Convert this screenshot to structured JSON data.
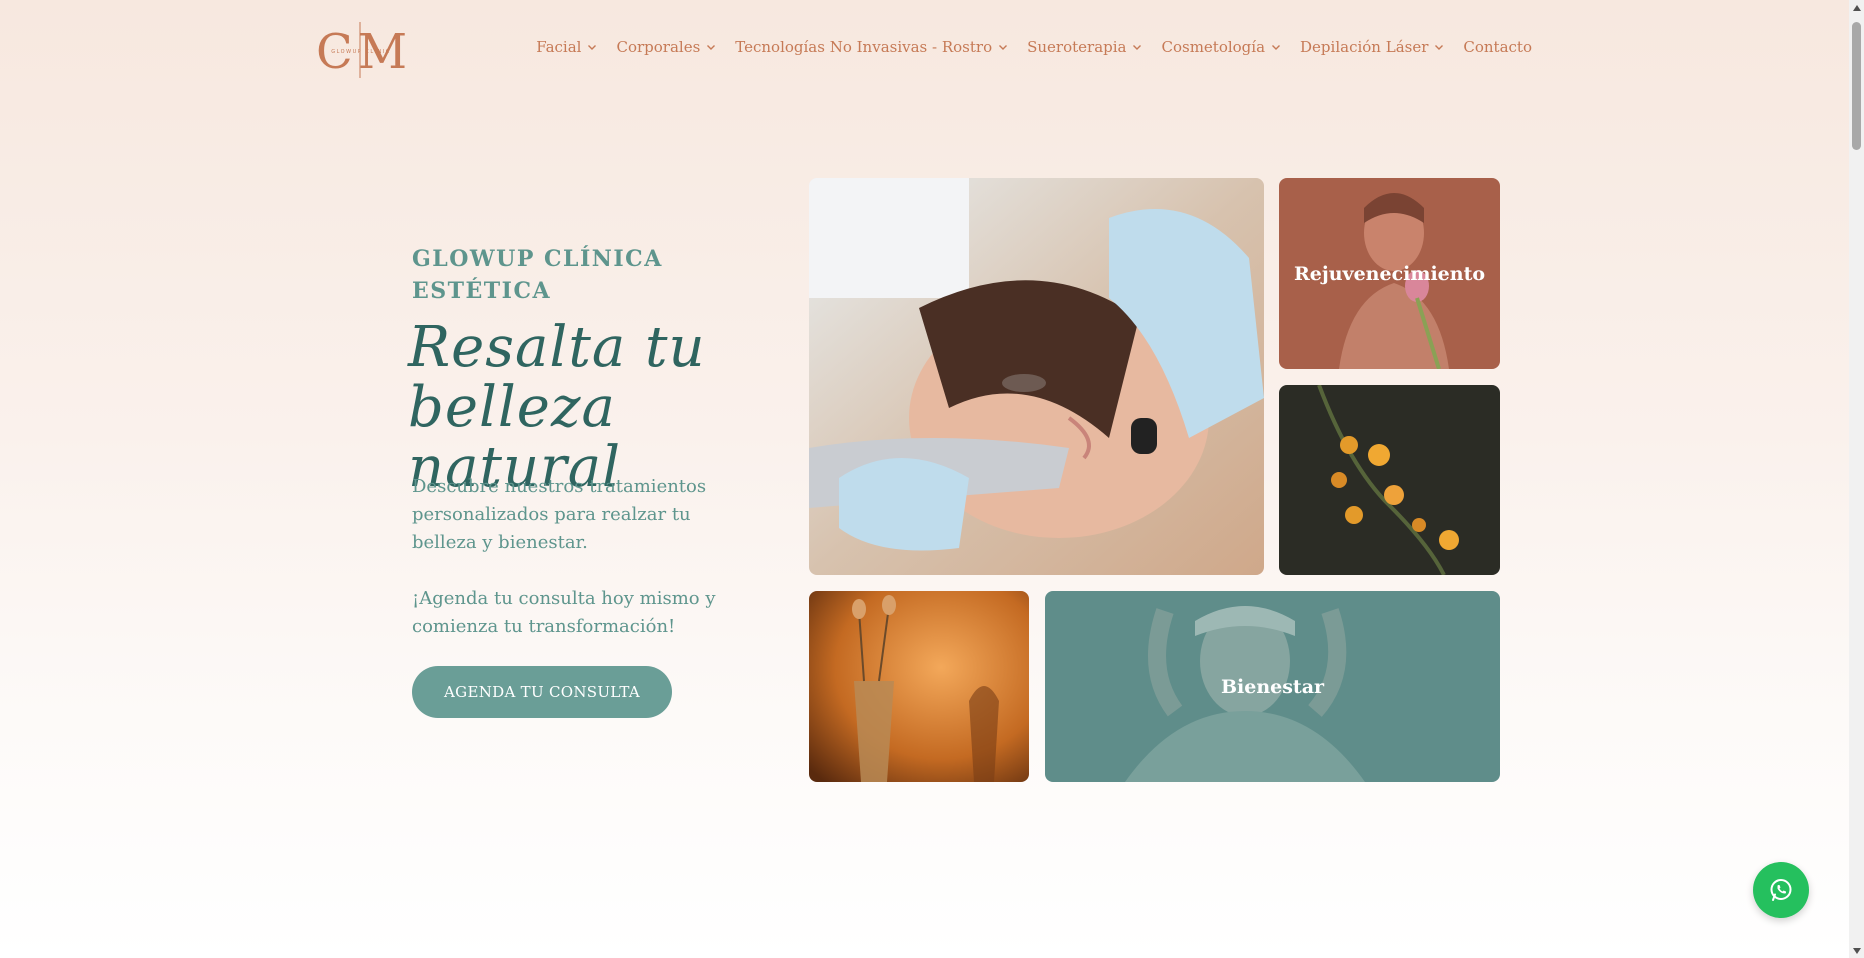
{
  "logo": {
    "letters": "CM",
    "subtext": "GLOWUP CLINIC"
  },
  "nav": {
    "items": [
      {
        "label": "Facial",
        "has_dropdown": true
      },
      {
        "label": "Corporales",
        "has_dropdown": true
      },
      {
        "label": "Tecnologías No Invasivas - Rostro",
        "has_dropdown": true
      },
      {
        "label": "Sueroterapia",
        "has_dropdown": true
      },
      {
        "label": "Cosmetología",
        "has_dropdown": true
      },
      {
        "label": "Depilación Láser",
        "has_dropdown": true
      },
      {
        "label": "Contacto",
        "has_dropdown": false
      }
    ]
  },
  "hero": {
    "eyebrow": "GLOWUP CLÍNICA ESTÉTICA",
    "headline": "Resalta tu belleza natural",
    "description": "Descubre nuestros tratamientos personalizados para realzar tu belleza y bienestar.",
    "cta_text": "¡Agenda tu consulta hoy mismo y comienza tu transformación!",
    "cta_button": "AGENDA TU CONSULTA"
  },
  "gallery": {
    "rejuvenecimiento_label": "Rejuvenecimiento",
    "bienestar_label": "Bienestar"
  },
  "colors": {
    "nav_text": "#c67a56",
    "teal_text": "#5e958d",
    "headline": "#2f6560",
    "button": "#6a9e97",
    "whatsapp": "#25c05e"
  },
  "icons": {
    "whatsapp": "whatsapp-icon",
    "dropdown": "chevron-down-icon"
  }
}
